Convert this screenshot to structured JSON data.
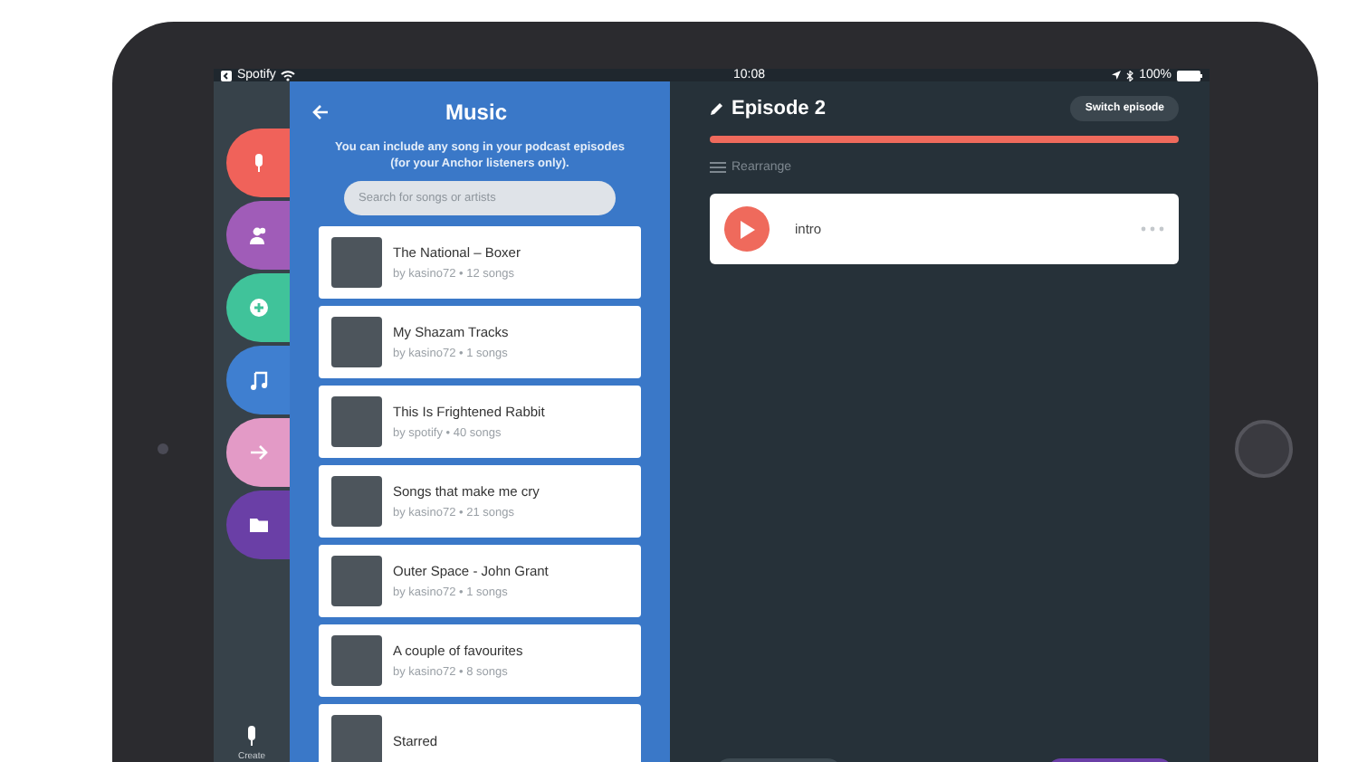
{
  "status_bar": {
    "back_app": "Spotify",
    "time": "10:08",
    "battery": "100%"
  },
  "sidebar": {
    "items": [
      {
        "kind": "mic",
        "color": "#f0625a"
      },
      {
        "kind": "people",
        "color": "#a05cb8"
      },
      {
        "kind": "plus",
        "color": "#40c39a"
      },
      {
        "kind": "music",
        "color": "#3f7fd0"
      },
      {
        "kind": "arrow",
        "color": "#e39ac6"
      },
      {
        "kind": "folder",
        "color": "#6a3fa6"
      }
    ],
    "create_label": "Create"
  },
  "music_panel": {
    "title": "Music",
    "description": "You can include any song in your podcast episodes (for your Anchor listeners only).",
    "search": {
      "placeholder": "Search for songs or artists"
    },
    "playlists": [
      {
        "title": "The National – Boxer",
        "subtitle": "by kasino72 • 12 songs"
      },
      {
        "title": "My Shazam Tracks",
        "subtitle": "by kasino72 • 1 songs"
      },
      {
        "title": "This Is Frightened Rabbit",
        "subtitle": "by spotify • 40 songs"
      },
      {
        "title": "Songs that make me cry",
        "subtitle": "by kasino72 • 21 songs"
      },
      {
        "title": "Outer Space - John Grant",
        "subtitle": "by kasino72 • 1 songs"
      },
      {
        "title": "A couple of favourites",
        "subtitle": "by kasino72 • 8 songs"
      },
      {
        "title": "Starred"
      }
    ]
  },
  "episode": {
    "title": "Episode 2",
    "switch_button": "Switch episode",
    "rearrange": "Rearrange",
    "segments": [
      {
        "title": "intro"
      }
    ]
  }
}
